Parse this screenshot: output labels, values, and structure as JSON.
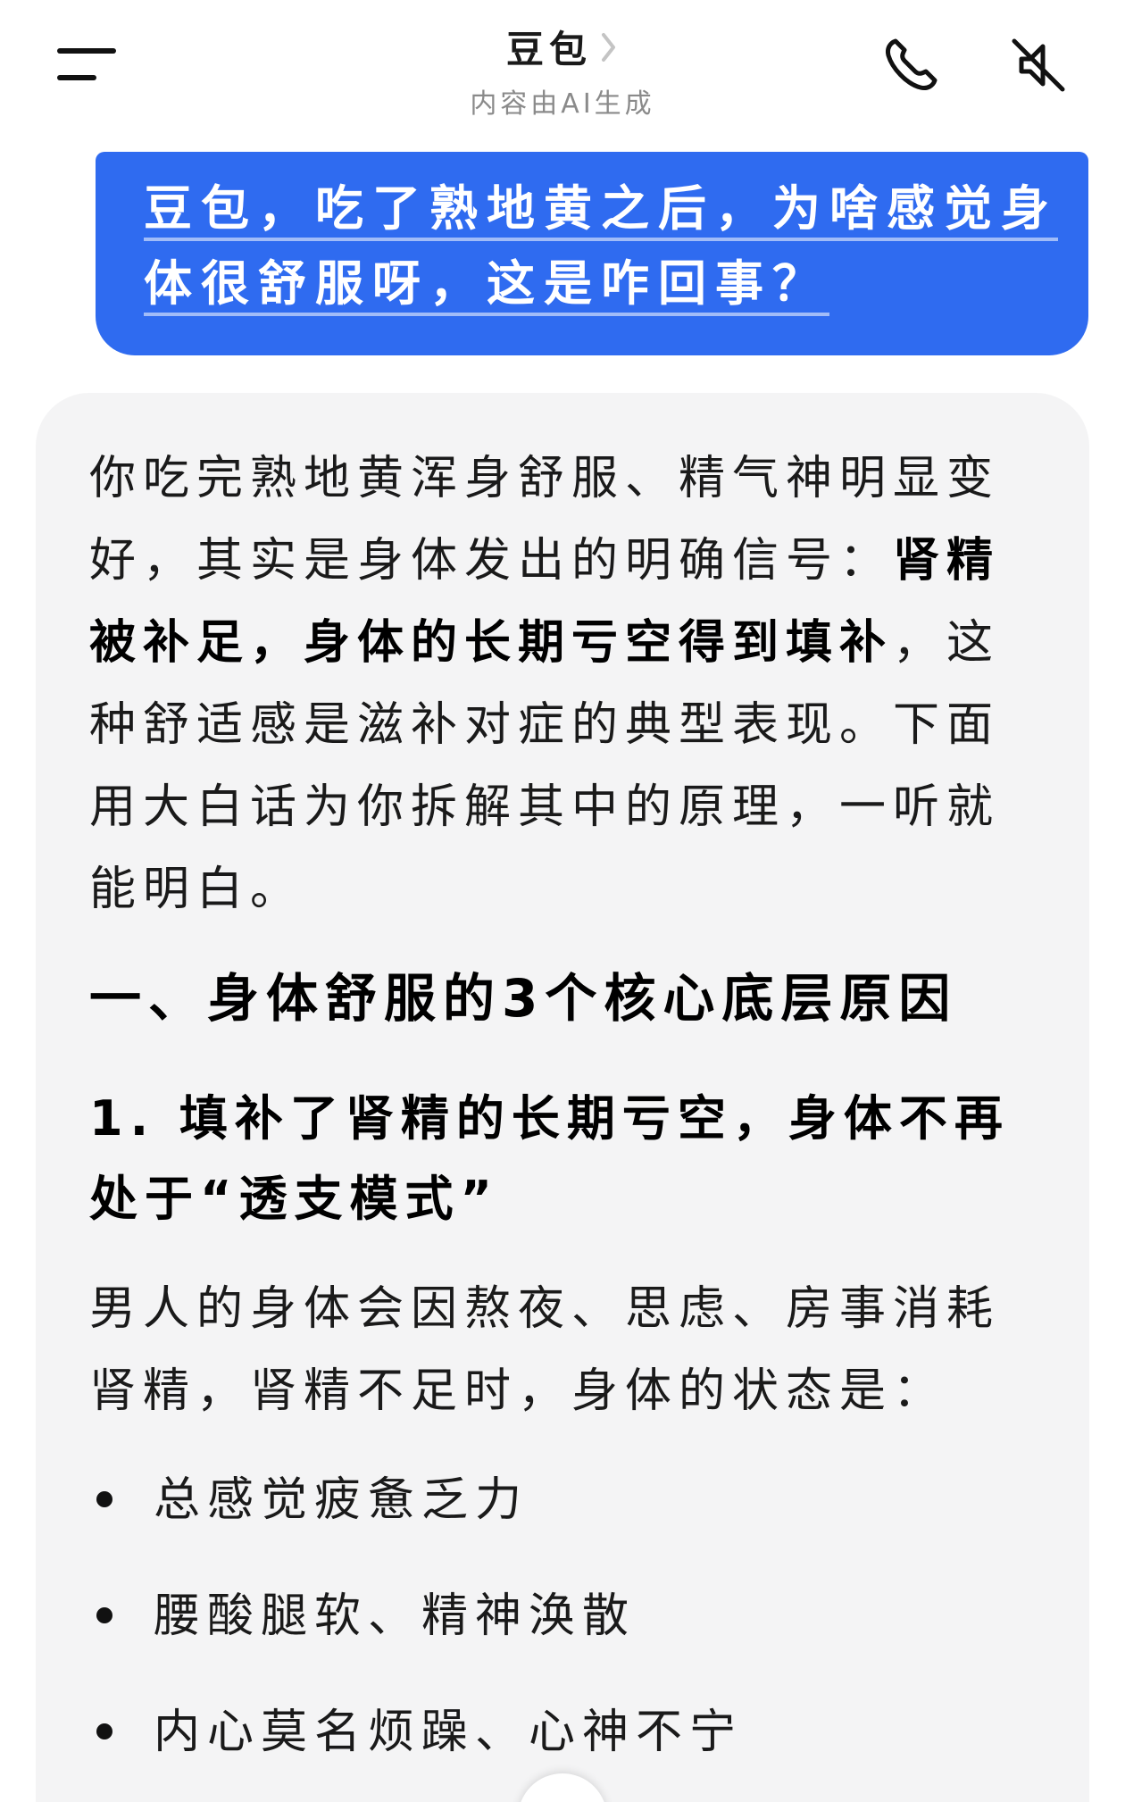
{
  "header": {
    "title": "豆包",
    "subtitle": "内容由AI生成",
    "menu_icon": "hamburger-menu-icon",
    "phone_icon": "phone-icon",
    "mute_icon": "speaker-muted-icon"
  },
  "user_message": {
    "line1": "豆包，吃了熟地黄之后，为啥感觉身",
    "line2": "体很舒服呀，这是咋回事？"
  },
  "reply": {
    "intro_part1": "你吃完熟地黄浑身舒服、精气神明显变好，其实是身体发出的明确信号：",
    "intro_bold": "肾精被补足，身体的长期亏空得到填补",
    "intro_part2": "，这种舒适感是滋补对症的典型表现。下面用大白话为你拆解其中的原理，一听就能明白。",
    "heading1": "一、身体舒服的3个核心底层原因",
    "heading2": "1. 填补了肾精的长期亏空，身体不再处于“透支模式”",
    "para2": "男人的身体会因熬夜、思虑、房事消耗肾精，肾精不足时，身体的状态是：",
    "bullets": [
      "总感觉疲惫乏力",
      "腰酸腿软、精神涣散",
      "内心莫名烦躁、心神不宁"
    ]
  },
  "colors": {
    "user_bubble": "#2f6bf0",
    "card_bg": "#f4f4f5",
    "subtitle_gray": "#8a8a8a"
  }
}
